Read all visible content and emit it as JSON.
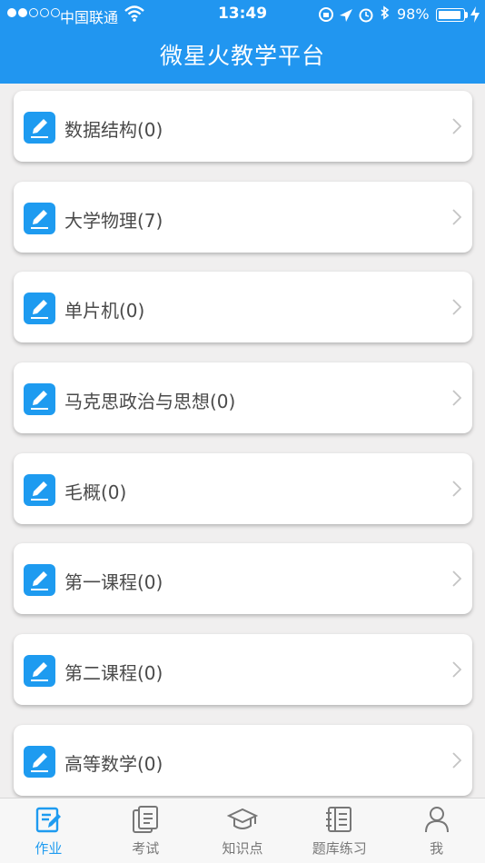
{
  "status_bar": {
    "carrier": "中国联通",
    "time": "13:49",
    "battery": "98%"
  },
  "nav": {
    "title": "微星火教学平台"
  },
  "courses": [
    {
      "label": "数据结构(0)"
    },
    {
      "label": "大学物理(7)"
    },
    {
      "label": "单片机(0)"
    },
    {
      "label": "马克思政治与思想(0)"
    },
    {
      "label": "毛概(0)"
    },
    {
      "label": "第一课程(0)"
    },
    {
      "label": "第二课程(0)"
    },
    {
      "label": "高等数学(0)"
    }
  ],
  "tabs": [
    {
      "label": "作业",
      "icon": "homework-icon",
      "active": true
    },
    {
      "label": "考试",
      "icon": "exam-icon",
      "active": false
    },
    {
      "label": "知识点",
      "icon": "graduation-cap-icon",
      "active": false
    },
    {
      "label": "题库练习",
      "icon": "question-bank-icon",
      "active": false
    },
    {
      "label": "我",
      "icon": "user-icon",
      "active": false
    }
  ],
  "colors": {
    "accent": "#2196f0",
    "icon_bg": "#1e9bf0",
    "background": "#f0efef"
  }
}
